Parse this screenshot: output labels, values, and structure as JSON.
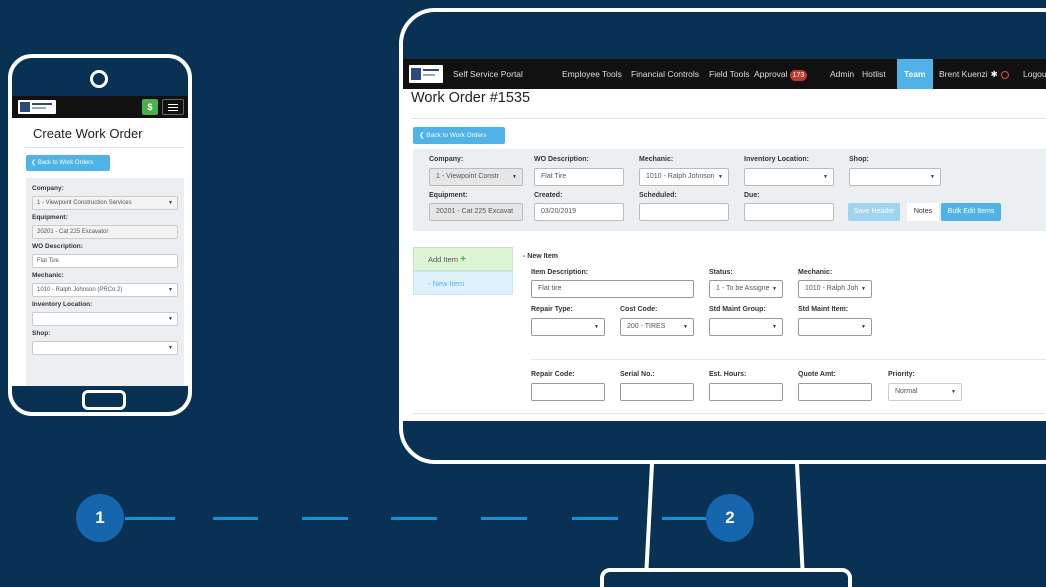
{
  "phone": {
    "title": "Create Work Order",
    "dollar_label": "$",
    "back_label": "❮ Back to Work Orders",
    "fields": [
      {
        "label": "Company:",
        "value": "1 - Viewpoint Construction Services",
        "select": true
      },
      {
        "label": "Equipment:",
        "value": "20201 - Cat 225 Excavator",
        "select": false
      },
      {
        "label": "WO Description:",
        "value": "Flat Tire",
        "select": false
      },
      {
        "label": "Mechanic:",
        "value": "1010 - Ralph Johnson (PRCo 2)",
        "select": true
      },
      {
        "label": "Inventory Location:",
        "value": "",
        "select": true
      },
      {
        "label": "Shop:",
        "value": "",
        "select": true
      }
    ]
  },
  "nav": {
    "portal": "Self Service Portal",
    "employee_tools": "Employee Tools",
    "financial_controls": "Financial Controls",
    "field_tools": "Field Tools",
    "approval": "Approval",
    "approval_count": "173",
    "admin": "Admin",
    "hotlist": "Hotlist",
    "team": "Team",
    "user": "Brent Kuenzi",
    "logout": "Logout"
  },
  "work_order": {
    "title": "Work Order #1535",
    "back_label": "❮ Back to Work Orders",
    "header": {
      "company_label": "Company:",
      "company_value": "1 - Viewpoint Constr",
      "wo_desc_label": "WO Description:",
      "wo_desc_value": "Flat Tire",
      "mechanic_label": "Mechanic:",
      "mechanic_value": "1010 - Ralph Johnson",
      "inventory_label": "Inventory Location:",
      "inventory_value": "",
      "shop_label": "Shop:",
      "shop_value": "",
      "equipment_label": "Equipment:",
      "equipment_value": "20201 - Cat 225 Excavat",
      "created_label": "Created:",
      "created_value": "03/20/2019",
      "scheduled_label": "Scheduled:",
      "scheduled_value": "",
      "due_label": "Due:",
      "due_value": "",
      "save_header": "Save Header",
      "notes": "Notes",
      "bulk_edit": "Bulk Edit Items"
    },
    "items": {
      "add_item": "Add Item",
      "add_icon": "+",
      "list_item": "- New Item",
      "section_title": "- New Item",
      "item_desc_label": "Item Description:",
      "item_desc_value": "Flat tire",
      "status_label": "Status:",
      "status_value": "1 - To be Assigne",
      "mechanic_label": "Mechanic:",
      "mechanic_value": "1010 - Ralph Joh",
      "repair_type_label": "Repair Type:",
      "repair_type_value": "",
      "cost_code_label": "Cost Code:",
      "cost_code_value": "200 - TIRES",
      "std_maint_group_label": "Std Maint Group:",
      "std_maint_group_value": "",
      "std_maint_item_label": "Std Maint Item:",
      "std_maint_item_value": "",
      "repair_code_label": "Repair Code:",
      "repair_code_value": "",
      "serial_label": "Serial No.:",
      "serial_value": "",
      "est_hours_label": "Est. Hours:",
      "est_hours_value": "",
      "quote_label": "Quote Amt:",
      "quote_value": "",
      "priority_label": "Priority:",
      "priority_value": "Normal"
    }
  },
  "steps": {
    "one": "1",
    "two": "2"
  },
  "colors": {
    "background": "#083154",
    "accent": "#4fb3e8",
    "step": "#1666ad",
    "dash": "#1a8fd6",
    "badge": "#c0392b"
  }
}
